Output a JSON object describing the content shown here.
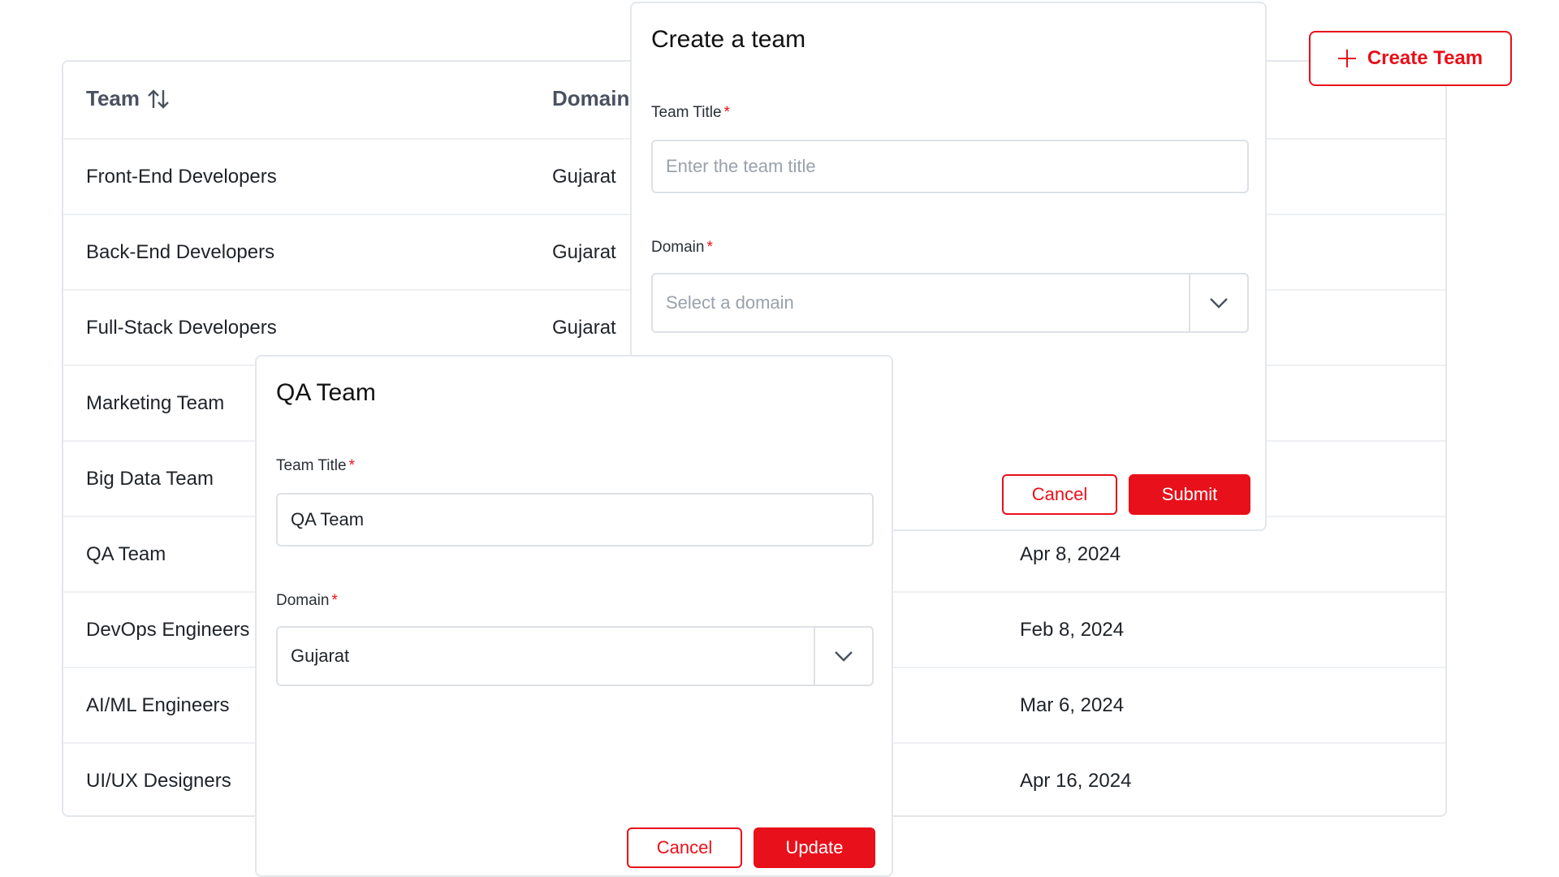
{
  "table": {
    "headers": {
      "team": "Team",
      "domain": "Domain"
    },
    "rows": [
      {
        "name": "Front-End Developers",
        "domain": "Gujarat",
        "date": ""
      },
      {
        "name": "Back-End Developers",
        "domain": "Gujarat",
        "date": ""
      },
      {
        "name": "Full-Stack Developers",
        "domain": "Gujarat",
        "date": ""
      },
      {
        "name": "Marketing Team",
        "domain": "",
        "date": ""
      },
      {
        "name": "Big Data Team",
        "domain": "",
        "date": ""
      },
      {
        "name": "QA Team",
        "domain": "",
        "date": "Apr 8, 2024"
      },
      {
        "name": "DevOps Engineers",
        "domain": "",
        "date": "Feb 8, 2024"
      },
      {
        "name": "AI/ML Engineers",
        "domain": "",
        "date": "Mar 6, 2024"
      },
      {
        "name": "UI/UX Designers",
        "domain": "",
        "date": "Apr 16, 2024"
      }
    ]
  },
  "header": {
    "create_button_label": "Create Team",
    "create_icon": "plus-icon"
  },
  "create_dialog": {
    "title": "Create a team",
    "team_title_label": "Team Title",
    "team_title_placeholder": "Enter the team title",
    "team_title_value": "",
    "domain_label": "Domain",
    "domain_placeholder": "Select a domain",
    "cancel_label": "Cancel",
    "submit_label": "Submit"
  },
  "edit_dialog": {
    "title": "QA Team",
    "team_title_label": "Team Title",
    "team_title_value": "QA Team",
    "domain_label": "Domain",
    "domain_value": "Gujarat",
    "cancel_label": "Cancel",
    "update_label": "Update"
  },
  "required_marker": "*",
  "colors": {
    "accent": "#e8101a",
    "border": "#dde1e6",
    "placeholder": "#9aa1ab"
  }
}
